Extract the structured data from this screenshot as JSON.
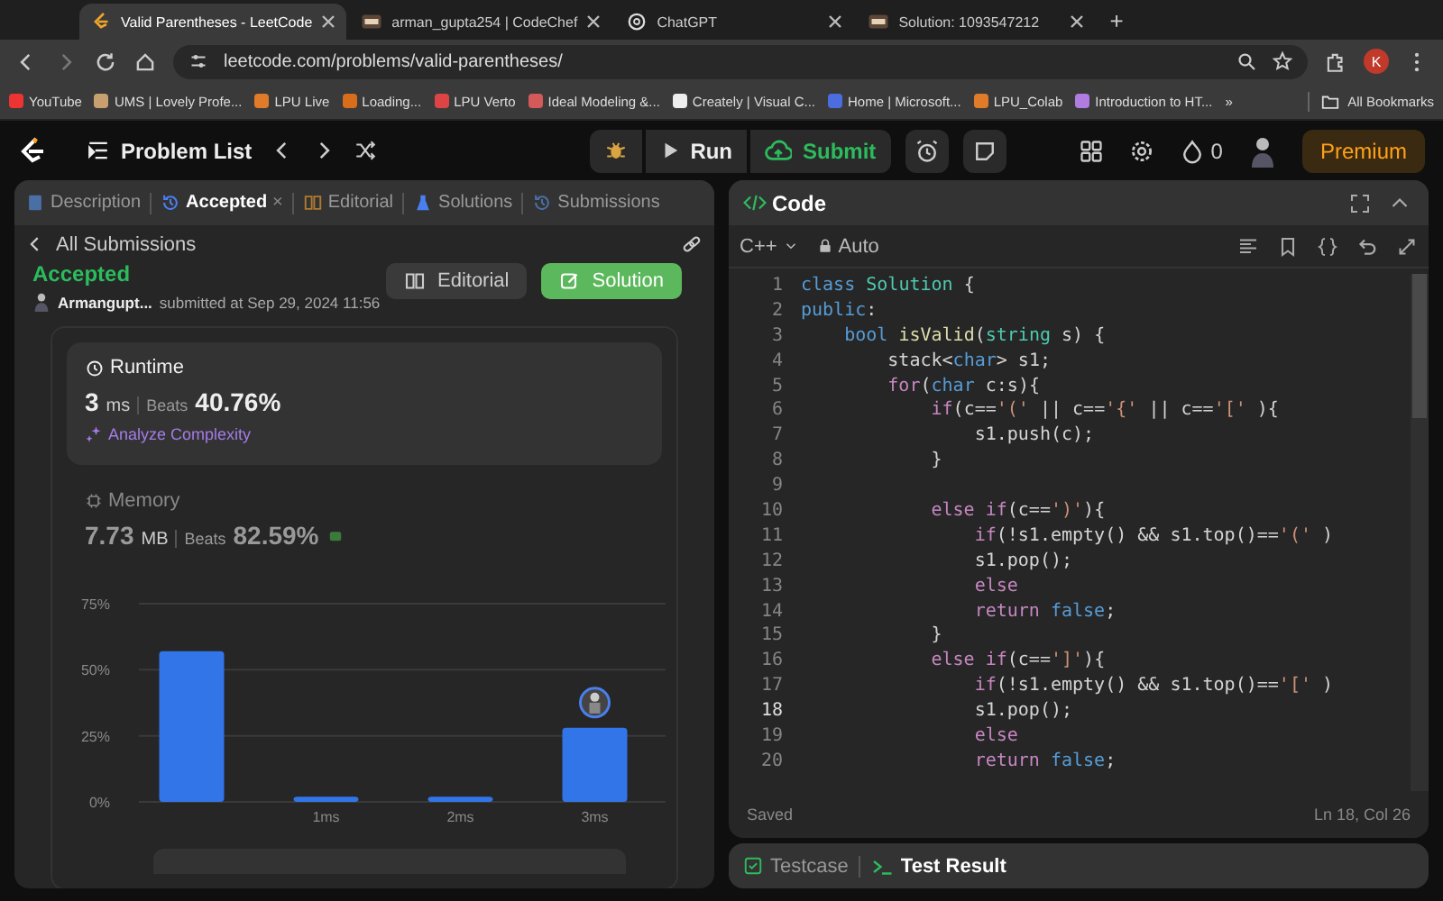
{
  "browser": {
    "tabs": [
      {
        "title": "Valid Parentheses - LeetCode",
        "kind": "leetcode",
        "selected": true
      },
      {
        "title": "arman_gupta254 | CodeChef",
        "kind": "chef",
        "selected": false
      },
      {
        "title": "ChatGPT",
        "kind": "chatgpt",
        "selected": false
      },
      {
        "title": "Solution: 1093547212",
        "kind": "chef",
        "selected": false
      }
    ],
    "new_tab": "+",
    "address": "leetcode.com/problems/valid-parentheses/",
    "profile": "K",
    "bookmarks": [
      "YouTube",
      "UMS | Lovely Profe...",
      "LPU Live",
      "Loading...",
      "LPU Verto",
      "Ideal Modeling &...",
      "Creately | Visual C...",
      "Home | Microsoft...",
      "LPU_Colab",
      "Introduction to HT..."
    ],
    "more_bookmarks": "»",
    "all_bookmarks": "All Bookmarks"
  },
  "header": {
    "problem_list": "Problem List",
    "run": "Run",
    "submit": "Submit",
    "streak": "0",
    "premium": "Premium"
  },
  "left_panel": {
    "tabs": [
      {
        "label": "Description",
        "selected": false,
        "closable": false
      },
      {
        "label": "Accepted",
        "selected": true,
        "closable": true
      },
      {
        "label": "Editorial",
        "selected": false,
        "closable": false
      },
      {
        "label": "Solutions",
        "selected": false,
        "closable": false
      },
      {
        "label": "Submissions",
        "selected": false,
        "closable": false
      }
    ],
    "close_mark": "×",
    "back_label": "All Submissions",
    "status": "Accepted",
    "user": "Armangupt...",
    "submitted": "submitted at Sep 29, 2024 11:56",
    "editorial_button": "Editorial",
    "solution_button": "Solution",
    "runtime": {
      "title": "Runtime",
      "value": "3",
      "unit": "ms",
      "beats_label": "Beats",
      "beats": "40.76%",
      "analyze": "Analyze Complexity"
    },
    "memory": {
      "title": "Memory",
      "value": "7.73",
      "unit": "MB",
      "beats_label": "Beats",
      "beats": "82.59%"
    },
    "chart_data": {
      "type": "bar",
      "categories": [
        null,
        "1ms",
        "2ms",
        "3ms"
      ],
      "values": [
        57,
        2,
        2,
        28
      ],
      "ylim": [
        0,
        75
      ],
      "yticks": [
        {
          "value": 0,
          "label": "0%"
        },
        {
          "value": 25,
          "label": "25%"
        },
        {
          "value": 50,
          "label": "50%"
        },
        {
          "value": 75,
          "label": "75%"
        }
      ]
    }
  },
  "code_panel": {
    "title": "Code",
    "language": "C++",
    "mode": "Auto",
    "lines": [
      {
        "number": "1",
        "current": false,
        "tokens": [
          {
            "kind": "kw",
            "text": "class"
          },
          {
            "kind": "type",
            "text": " Solution"
          },
          {
            "kind": "p",
            "text": " {"
          }
        ]
      },
      {
        "number": "2",
        "current": false,
        "tokens": [
          {
            "kind": "kw",
            "text": "public"
          },
          {
            "kind": "p",
            "text": ":"
          }
        ]
      },
      {
        "number": "3",
        "current": false,
        "tokens": [
          {
            "kind": "kw",
            "text": "    bool"
          },
          {
            "kind": "fn",
            "text": " isValid"
          },
          {
            "kind": "p",
            "text": "("
          },
          {
            "kind": "type",
            "text": "string"
          },
          {
            "kind": "p",
            "text": " s) {"
          }
        ]
      },
      {
        "number": "4",
        "current": false,
        "tokens": [
          {
            "kind": "p",
            "text": "        stack<"
          },
          {
            "kind": "kw",
            "text": "char"
          },
          {
            "kind": "p",
            "text": "> s1;"
          }
        ]
      },
      {
        "number": "5",
        "current": false,
        "tokens": [
          {
            "kind": "ctl",
            "text": "        for"
          },
          {
            "kind": "p",
            "text": "("
          },
          {
            "kind": "kw",
            "text": "char"
          },
          {
            "kind": "p",
            "text": " c:s){"
          }
        ]
      },
      {
        "number": "6",
        "current": false,
        "tokens": [
          {
            "kind": "ctl",
            "text": "            if"
          },
          {
            "kind": "p",
            "text": "(c=="
          },
          {
            "kind": "str",
            "text": "'('"
          },
          {
            "kind": "p",
            "text": " || c=="
          },
          {
            "kind": "str",
            "text": "'{'"
          },
          {
            "kind": "p",
            "text": " || c=="
          },
          {
            "kind": "str",
            "text": "'['"
          },
          {
            "kind": "p",
            "text": " ){"
          }
        ]
      },
      {
        "number": "7",
        "current": false,
        "tokens": [
          {
            "kind": "p",
            "text": "                s1.push(c);"
          }
        ]
      },
      {
        "number": "8",
        "current": false,
        "tokens": [
          {
            "kind": "p",
            "text": "            }"
          }
        ]
      },
      {
        "number": "9",
        "current": false
      },
      {
        "number": "10",
        "current": false,
        "tokens": [
          {
            "kind": "ctl",
            "text": "            else if"
          },
          {
            "kind": "p",
            "text": "(c=="
          },
          {
            "kind": "str",
            "text": "')'"
          },
          {
            "kind": "p",
            "text": "){"
          }
        ]
      },
      {
        "number": "11",
        "current": false,
        "tokens": [
          {
            "kind": "ctl",
            "text": "                if"
          },
          {
            "kind": "p",
            "text": "(!s1.empty() && s1.top()=="
          },
          {
            "kind": "str",
            "text": "'('"
          },
          {
            "kind": "p",
            "text": " )"
          }
        ]
      },
      {
        "number": "12",
        "current": false,
        "tokens": [
          {
            "kind": "p",
            "text": "                s1.pop();"
          }
        ]
      },
      {
        "number": "13",
        "current": false,
        "tokens": [
          {
            "kind": "ctl",
            "text": "                else"
          }
        ]
      },
      {
        "number": "14",
        "current": false,
        "tokens": [
          {
            "kind": "ctl",
            "text": "                return"
          },
          {
            "kind": "kw",
            "text": " false"
          },
          {
            "kind": "p",
            "text": ";"
          }
        ]
      },
      {
        "number": "15",
        "current": false,
        "tokens": [
          {
            "kind": "p",
            "text": "            }"
          }
        ]
      },
      {
        "number": "16",
        "current": false,
        "tokens": [
          {
            "kind": "ctl",
            "text": "            else if"
          },
          {
            "kind": "p",
            "text": "(c=="
          },
          {
            "kind": "str",
            "text": "']'"
          },
          {
            "kind": "p",
            "text": "){"
          }
        ]
      },
      {
        "number": "17",
        "current": false,
        "tokens": [
          {
            "kind": "ctl",
            "text": "                if"
          },
          {
            "kind": "p",
            "text": "(!s1.empty() && s1.top()=="
          },
          {
            "kind": "str",
            "text": "'['"
          },
          {
            "kind": "p",
            "text": " )"
          }
        ]
      },
      {
        "number": "18",
        "current": true,
        "tokens": [
          {
            "kind": "p",
            "text": "                s1.pop();"
          }
        ]
      },
      {
        "number": "19",
        "current": false,
        "tokens": [
          {
            "kind": "ctl",
            "text": "                else"
          }
        ]
      },
      {
        "number": "20",
        "current": false,
        "tokens": [
          {
            "kind": "ctl",
            "text": "                return"
          },
          {
            "kind": "kw",
            "text": " false"
          },
          {
            "kind": "p",
            "text": ";"
          }
        ]
      }
    ],
    "status": "Saved",
    "cursor": "Ln 18, Col 26"
  },
  "bottom_panel": {
    "tabs": [
      {
        "label": "Testcase",
        "selected": false
      },
      {
        "label": "Test Result",
        "selected": true
      }
    ]
  }
}
